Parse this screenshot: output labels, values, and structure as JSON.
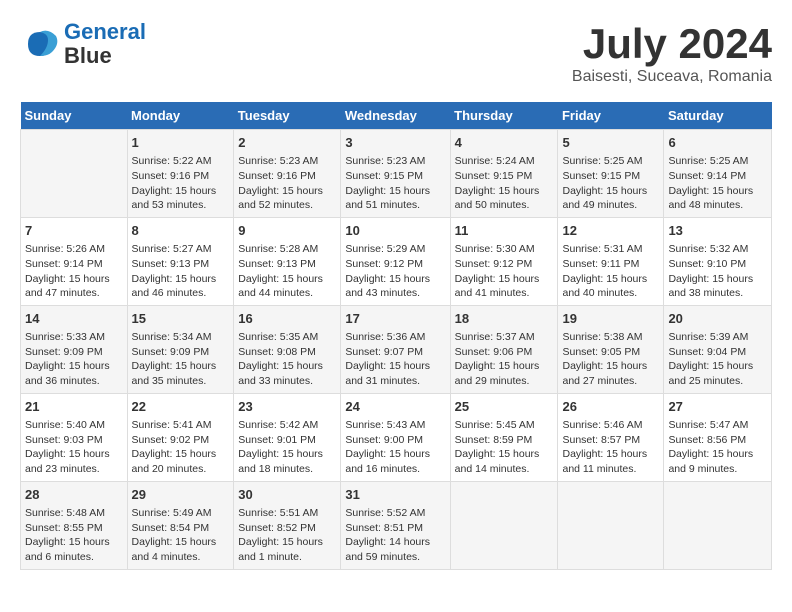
{
  "header": {
    "logo_line1": "General",
    "logo_line2": "Blue",
    "title": "July 2024",
    "subtitle": "Baisesti, Suceava, Romania"
  },
  "calendar": {
    "weekdays": [
      "Sunday",
      "Monday",
      "Tuesday",
      "Wednesday",
      "Thursday",
      "Friday",
      "Saturday"
    ],
    "weeks": [
      [
        {
          "day": "",
          "info": ""
        },
        {
          "day": "1",
          "info": "Sunrise: 5:22 AM\nSunset: 9:16 PM\nDaylight: 15 hours\nand 53 minutes."
        },
        {
          "day": "2",
          "info": "Sunrise: 5:23 AM\nSunset: 9:16 PM\nDaylight: 15 hours\nand 52 minutes."
        },
        {
          "day": "3",
          "info": "Sunrise: 5:23 AM\nSunset: 9:15 PM\nDaylight: 15 hours\nand 51 minutes."
        },
        {
          "day": "4",
          "info": "Sunrise: 5:24 AM\nSunset: 9:15 PM\nDaylight: 15 hours\nand 50 minutes."
        },
        {
          "day": "5",
          "info": "Sunrise: 5:25 AM\nSunset: 9:15 PM\nDaylight: 15 hours\nand 49 minutes."
        },
        {
          "day": "6",
          "info": "Sunrise: 5:25 AM\nSunset: 9:14 PM\nDaylight: 15 hours\nand 48 minutes."
        }
      ],
      [
        {
          "day": "7",
          "info": "Sunrise: 5:26 AM\nSunset: 9:14 PM\nDaylight: 15 hours\nand 47 minutes."
        },
        {
          "day": "8",
          "info": "Sunrise: 5:27 AM\nSunset: 9:13 PM\nDaylight: 15 hours\nand 46 minutes."
        },
        {
          "day": "9",
          "info": "Sunrise: 5:28 AM\nSunset: 9:13 PM\nDaylight: 15 hours\nand 44 minutes."
        },
        {
          "day": "10",
          "info": "Sunrise: 5:29 AM\nSunset: 9:12 PM\nDaylight: 15 hours\nand 43 minutes."
        },
        {
          "day": "11",
          "info": "Sunrise: 5:30 AM\nSunset: 9:12 PM\nDaylight: 15 hours\nand 41 minutes."
        },
        {
          "day": "12",
          "info": "Sunrise: 5:31 AM\nSunset: 9:11 PM\nDaylight: 15 hours\nand 40 minutes."
        },
        {
          "day": "13",
          "info": "Sunrise: 5:32 AM\nSunset: 9:10 PM\nDaylight: 15 hours\nand 38 minutes."
        }
      ],
      [
        {
          "day": "14",
          "info": "Sunrise: 5:33 AM\nSunset: 9:09 PM\nDaylight: 15 hours\nand 36 minutes."
        },
        {
          "day": "15",
          "info": "Sunrise: 5:34 AM\nSunset: 9:09 PM\nDaylight: 15 hours\nand 35 minutes."
        },
        {
          "day": "16",
          "info": "Sunrise: 5:35 AM\nSunset: 9:08 PM\nDaylight: 15 hours\nand 33 minutes."
        },
        {
          "day": "17",
          "info": "Sunrise: 5:36 AM\nSunset: 9:07 PM\nDaylight: 15 hours\nand 31 minutes."
        },
        {
          "day": "18",
          "info": "Sunrise: 5:37 AM\nSunset: 9:06 PM\nDaylight: 15 hours\nand 29 minutes."
        },
        {
          "day": "19",
          "info": "Sunrise: 5:38 AM\nSunset: 9:05 PM\nDaylight: 15 hours\nand 27 minutes."
        },
        {
          "day": "20",
          "info": "Sunrise: 5:39 AM\nSunset: 9:04 PM\nDaylight: 15 hours\nand 25 minutes."
        }
      ],
      [
        {
          "day": "21",
          "info": "Sunrise: 5:40 AM\nSunset: 9:03 PM\nDaylight: 15 hours\nand 23 minutes."
        },
        {
          "day": "22",
          "info": "Sunrise: 5:41 AM\nSunset: 9:02 PM\nDaylight: 15 hours\nand 20 minutes."
        },
        {
          "day": "23",
          "info": "Sunrise: 5:42 AM\nSunset: 9:01 PM\nDaylight: 15 hours\nand 18 minutes."
        },
        {
          "day": "24",
          "info": "Sunrise: 5:43 AM\nSunset: 9:00 PM\nDaylight: 15 hours\nand 16 minutes."
        },
        {
          "day": "25",
          "info": "Sunrise: 5:45 AM\nSunset: 8:59 PM\nDaylight: 15 hours\nand 14 minutes."
        },
        {
          "day": "26",
          "info": "Sunrise: 5:46 AM\nSunset: 8:57 PM\nDaylight: 15 hours\nand 11 minutes."
        },
        {
          "day": "27",
          "info": "Sunrise: 5:47 AM\nSunset: 8:56 PM\nDaylight: 15 hours\nand 9 minutes."
        }
      ],
      [
        {
          "day": "28",
          "info": "Sunrise: 5:48 AM\nSunset: 8:55 PM\nDaylight: 15 hours\nand 6 minutes."
        },
        {
          "day": "29",
          "info": "Sunrise: 5:49 AM\nSunset: 8:54 PM\nDaylight: 15 hours\nand 4 minutes."
        },
        {
          "day": "30",
          "info": "Sunrise: 5:51 AM\nSunset: 8:52 PM\nDaylight: 15 hours\nand 1 minute."
        },
        {
          "day": "31",
          "info": "Sunrise: 5:52 AM\nSunset: 8:51 PM\nDaylight: 14 hours\nand 59 minutes."
        },
        {
          "day": "",
          "info": ""
        },
        {
          "day": "",
          "info": ""
        },
        {
          "day": "",
          "info": ""
        }
      ]
    ]
  }
}
